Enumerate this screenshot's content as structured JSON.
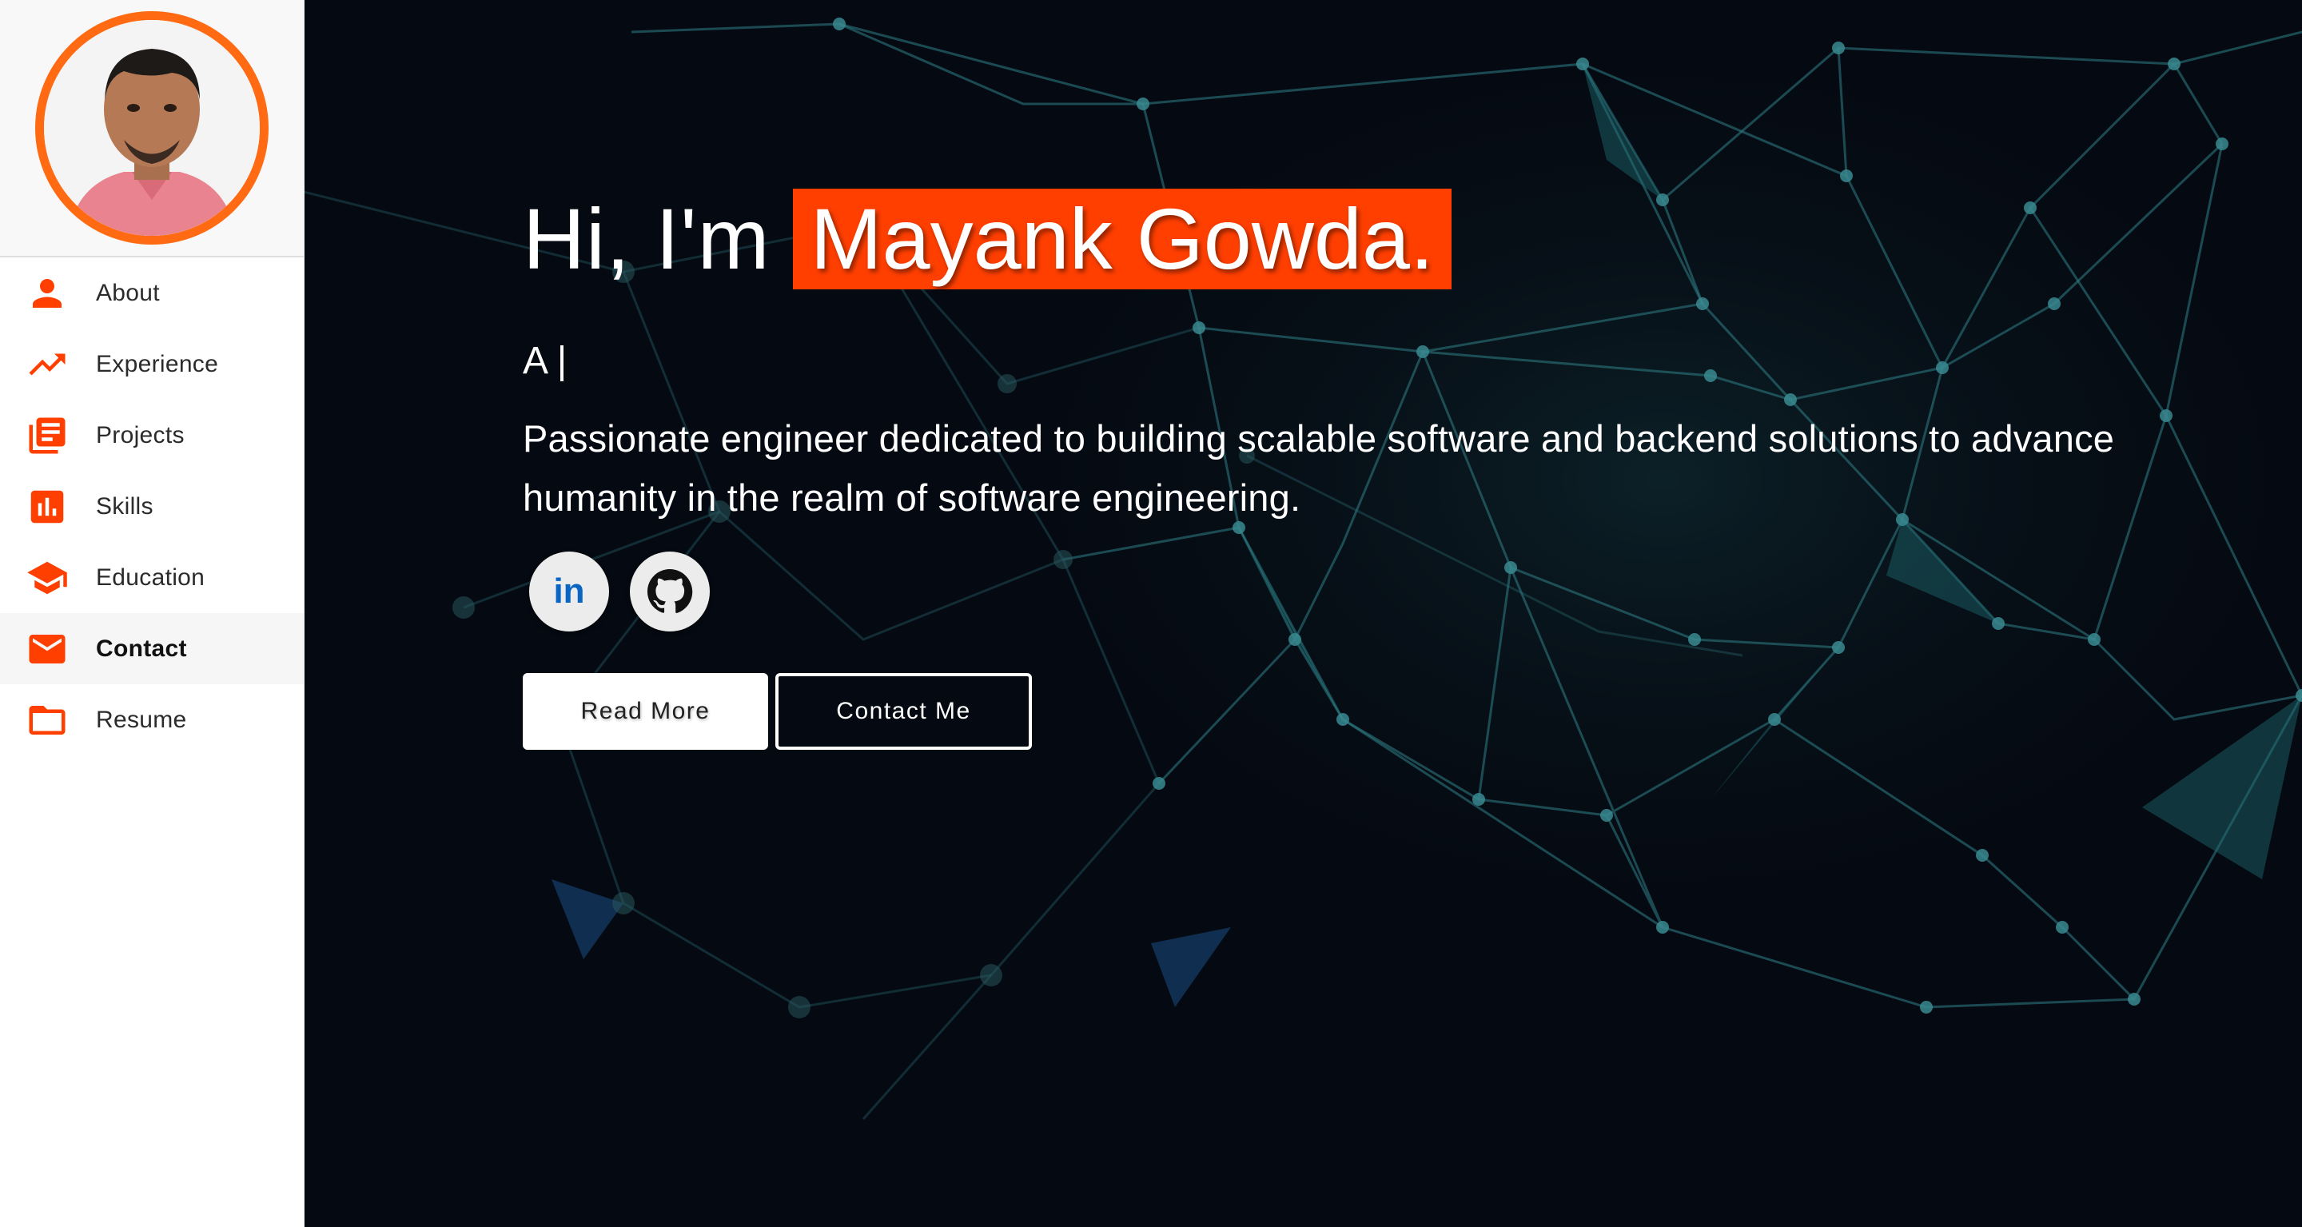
{
  "sidebar": {
    "items": [
      {
        "label": "About",
        "icon": "person-icon"
      },
      {
        "label": "Experience",
        "icon": "trending-up-icon"
      },
      {
        "label": "Projects",
        "icon": "library-books-icon"
      },
      {
        "label": "Skills",
        "icon": "bar-chart-icon"
      },
      {
        "label": "Education",
        "icon": "school-icon"
      },
      {
        "label": "Contact",
        "icon": "mail-icon",
        "active": true
      },
      {
        "label": "Resume",
        "icon": "folder-icon"
      }
    ]
  },
  "hero": {
    "greeting": "Hi, I'm",
    "name": "Mayank Gowda.",
    "typing_text": "A |",
    "tagline": "Passionate engineer dedicated to building scalable software and backend solutions to advance humanity in the realm of software engineering.",
    "socials": [
      {
        "name": "LinkedIn",
        "icon": "linkedin-icon"
      },
      {
        "name": "GitHub",
        "icon": "github-icon"
      }
    ],
    "buttons": {
      "read_more": "Read More",
      "contact_me": "Contact Me"
    }
  },
  "colors": {
    "accent": "#ff3f00",
    "avatar_ring": "#ff6a13",
    "hero_background": "#050a12",
    "network_lines": "#2f7f86"
  }
}
